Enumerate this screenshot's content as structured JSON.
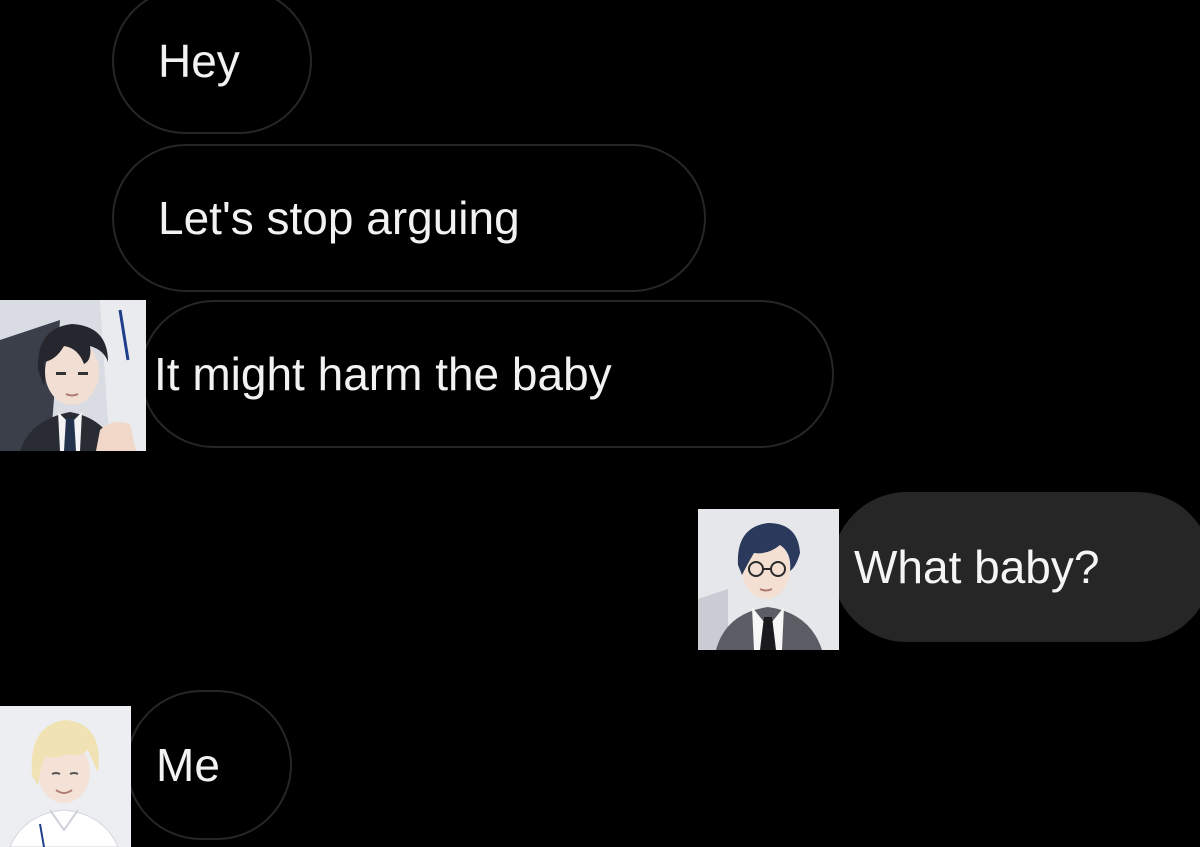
{
  "messages": [
    {
      "sender": "contact",
      "text": "Hey"
    },
    {
      "sender": "contact",
      "text": "Let's stop arguing"
    },
    {
      "sender": "contact",
      "text": "It might harm the baby",
      "avatar": "dark-haired-man-avatar"
    },
    {
      "sender": "me",
      "text": "What baby?",
      "avatar": "glasses-man-avatar"
    },
    {
      "sender": "contact",
      "text": "Me",
      "avatar": "blond-man-avatar"
    }
  ],
  "colors": {
    "background": "#000000",
    "incoming_border": "#262626",
    "outgoing_fill": "#262626",
    "text": "#f2f2f2"
  }
}
